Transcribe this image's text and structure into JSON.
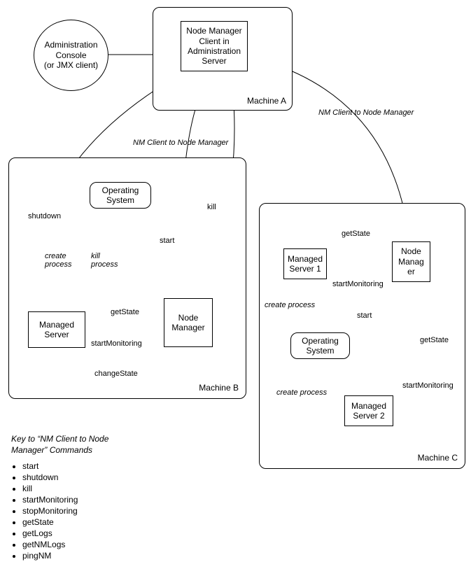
{
  "adminConsole": "Administration\nConsole\n(or JMX client)",
  "nmClient": "Node Manager\nClient in\nAdministration\nServer",
  "machineA": {
    "label": "Machine A"
  },
  "machineB": {
    "label": "Machine B",
    "os": "Operating\nSystem",
    "nodeManager": "Node\nManager",
    "managedServer": "Managed\nServer"
  },
  "machineC": {
    "label": "Machine C",
    "nodeManager": "Node\nManag\ner",
    "managedServer1": "Managed\nServer 1",
    "managedServer2": "Managed\nServer 2",
    "os": "Operating\nSystem"
  },
  "edges": {
    "nmClientToNodeManager": "NM Client to Node Manager",
    "shutdown": "shutdown",
    "kill": "kill",
    "start": "start",
    "createProcess": "create\nprocess",
    "killProcess": "kill\nprocess",
    "getState": "getState",
    "startMonitoring": "startMonitoring",
    "changeState": "changeState",
    "createProcessInline": "create process"
  },
  "key": {
    "title": "Key to “NM Client to Node\nManager” Commands",
    "items": [
      "start",
      "shutdown",
      "kill",
      "startMonitoring",
      "stopMonitoring",
      "getState",
      "getLogs",
      "getNMLogs",
      "pingNM"
    ]
  }
}
